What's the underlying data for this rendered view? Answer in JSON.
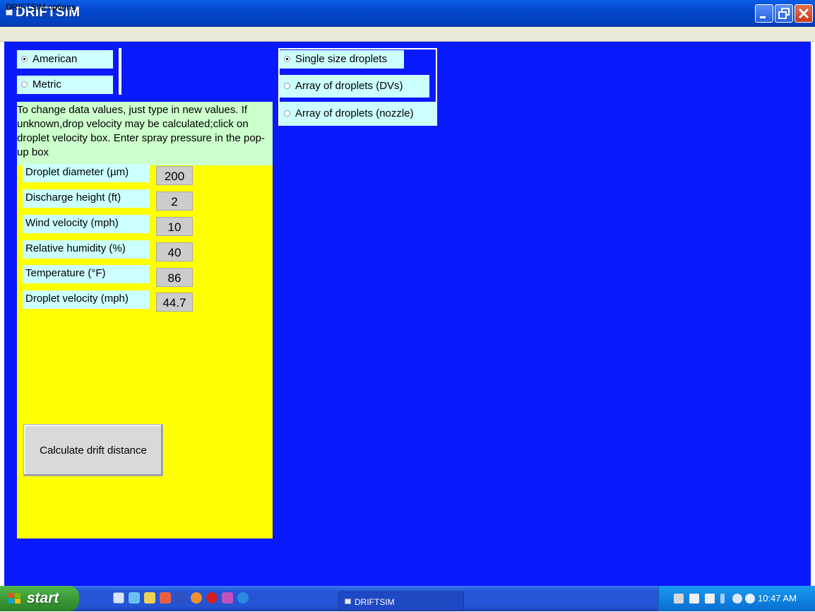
{
  "window": {
    "title": "DRIFTSIM"
  },
  "menu": {
    "items": [
      "DRIFTSIM options"
    ]
  },
  "units": {
    "options": [
      "American",
      "Metric"
    ],
    "selected": "American"
  },
  "droplet_mode": {
    "options": [
      "Single size droplets",
      "Array of droplets (DVs)",
      "Array of droplets (nozzle)"
    ],
    "selected": "Single size droplets"
  },
  "instructions": "To change data values, just type in new values. If unknown,drop velocity may be calculated;click on droplet velocity box. Enter spray pressure in the pop-up box",
  "fields": [
    {
      "label": "Droplet diameter (µm)",
      "value": "200"
    },
    {
      "label": "Discharge height (ft)",
      "value": "2"
    },
    {
      "label": "Wind velocity (mph)",
      "value": "10"
    },
    {
      "label": "Relative humidity (%)",
      "value": "40"
    },
    {
      "label": "Temperature (°F)",
      "value": "86"
    },
    {
      "label": "Droplet velocity (mph)",
      "value": "44.7"
    }
  ],
  "calculate_button": "Calculate drift distance",
  "taskbar": {
    "start_label": "start",
    "task_label": "DRIFTSIM",
    "clock": "10:47 AM"
  },
  "colors": {
    "client_bg": "#0a1aff",
    "panel_yellow": "#ffff00",
    "label_cyan": "#ccffff",
    "instructions_green": "#ccffcc"
  }
}
